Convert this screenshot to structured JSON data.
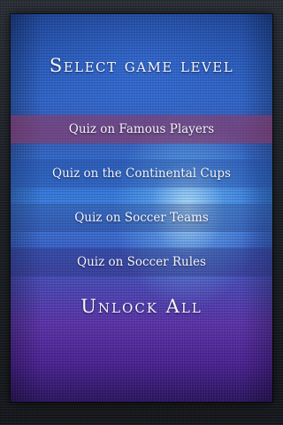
{
  "screen": {
    "title": "Select game level"
  },
  "levels": [
    {
      "label": "Quiz on Famous Players"
    },
    {
      "label": "Quiz on the Continental Cups"
    },
    {
      "label": "Quiz on Soccer Teams"
    },
    {
      "label": "Quiz on Soccer Rules"
    }
  ],
  "unlock": {
    "label": "Unlock All"
  },
  "colors": {
    "panel_top": "#1b3f8e",
    "panel_mid": "#3b7fe0",
    "panel_bottom": "#2c1660",
    "highlight_band": "#96375f",
    "text": "#f4f6ff"
  }
}
